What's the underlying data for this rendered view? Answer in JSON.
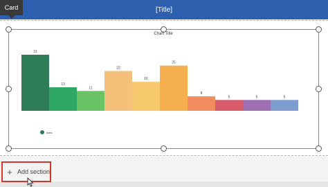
{
  "card_tab": {
    "label": "Card"
  },
  "header": {
    "title": "[Title]"
  },
  "chart_data": {
    "type": "bar",
    "title": "Chart Title",
    "categories": [
      "",
      "",
      "",
      "",
      "",
      "",
      "",
      "",
      "",
      ""
    ],
    "values": [
      31,
      13,
      11,
      22,
      16,
      25,
      8,
      6,
      6,
      6
    ],
    "colors": [
      "#2e7d58",
      "#2fa866",
      "#69c263",
      "#f4c07a",
      "#f5c86c",
      "#f6b04f",
      "#f28c5e",
      "#d95c6a",
      "#9d6fb0",
      "#7d9cd0"
    ],
    "ylim": [
      0,
      31
    ],
    "legend": {
      "label": "Area",
      "color": "#2e7d58",
      "position": "bottom-left"
    },
    "grid": false
  },
  "bottom": {
    "add_section_label": "Add section",
    "plus_symbol": "+"
  }
}
